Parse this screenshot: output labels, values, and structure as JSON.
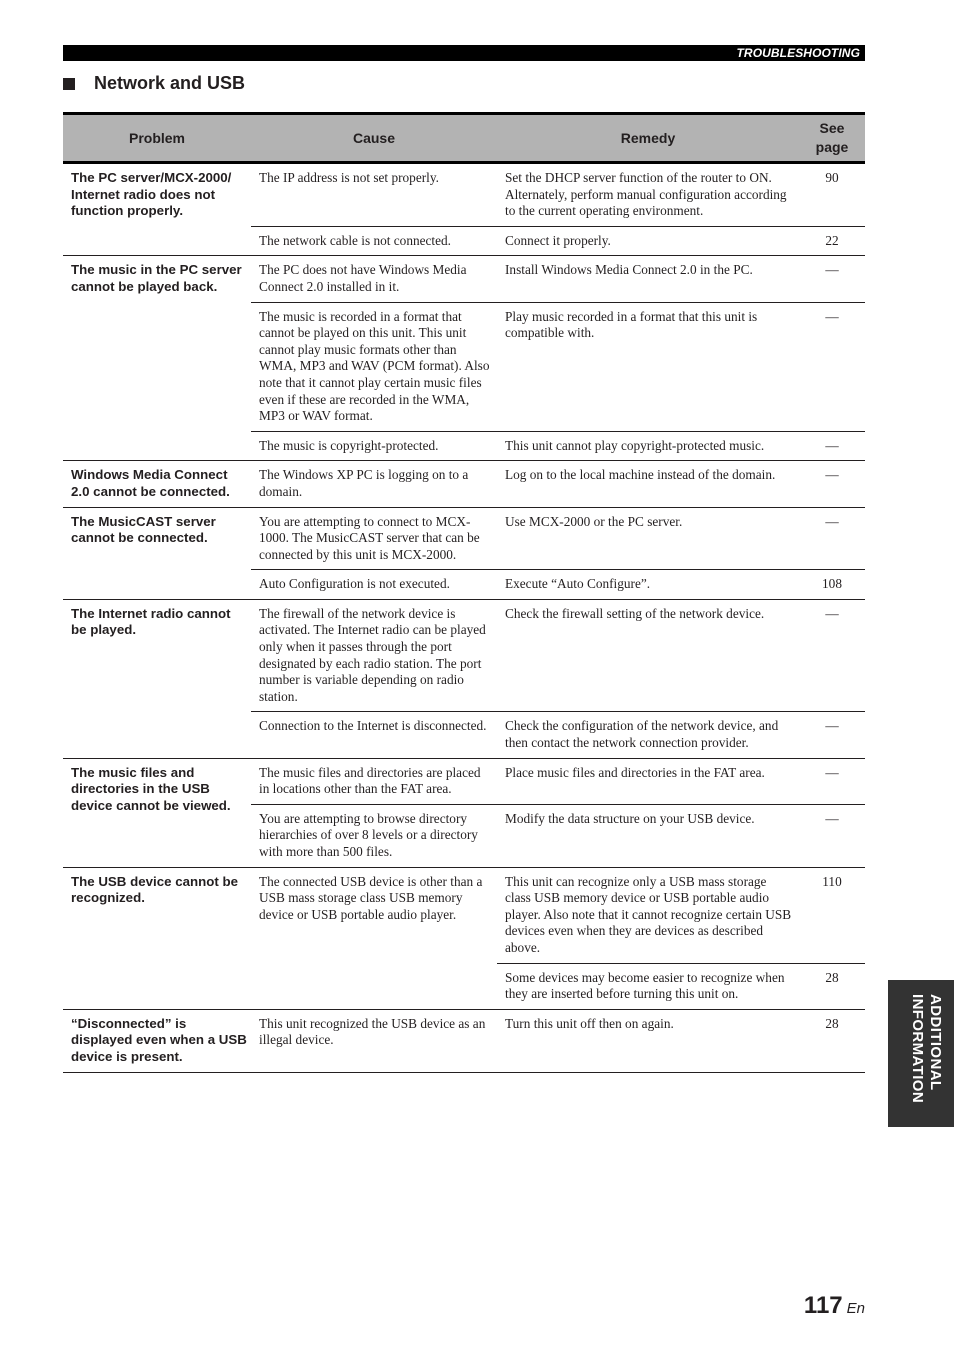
{
  "header": {
    "section_label": "TROUBLESHOOTING"
  },
  "section": {
    "title": "Network and USB"
  },
  "table": {
    "columns": [
      "Problem",
      "Cause",
      "Remedy",
      "See page"
    ],
    "columns_split": {
      "see": "See",
      "page": "page"
    },
    "groups": [
      {
        "problem": "The PC server/MCX-2000/ Internet radio does not function properly.",
        "rows": [
          {
            "cause": "The IP address is not set properly.",
            "remedy": "Set the DHCP server function of the router to ON. Alternately, perform manual configuration according to the current operating environment.",
            "page": "90"
          },
          {
            "cause": "The network cable is not connected.",
            "remedy": "Connect it properly.",
            "page": "22"
          }
        ]
      },
      {
        "problem": "The music in the PC server cannot be played back.",
        "rows": [
          {
            "cause": "The PC does not have Windows Media Connect 2.0 installed in it.",
            "remedy": "Install Windows Media Connect 2.0 in the PC.",
            "page": "—"
          },
          {
            "cause": "The music is recorded in a format that cannot be played on this unit. This unit cannot play music formats other than WMA, MP3 and WAV (PCM format). Also note that it cannot play certain music files even if these are recorded in the WMA, MP3 or WAV format.",
            "remedy": "Play music recorded in a format that this unit is compatible with.",
            "page": "—"
          },
          {
            "cause": "The music is copyright-protected.",
            "remedy": "This unit cannot play copyright-protected music.",
            "page": "—"
          }
        ]
      },
      {
        "problem": "Windows Media Connect 2.0 cannot be connected.",
        "rows": [
          {
            "cause": "The Windows XP PC is logging on to a domain.",
            "remedy": "Log on to the local machine instead of the domain.",
            "page": "—"
          }
        ]
      },
      {
        "problem": "The MusicCAST server cannot be connected.",
        "rows": [
          {
            "cause": "You are attempting to connect to MCX-1000. The MusicCAST server that can be connected by this unit is MCX-2000.",
            "remedy": "Use MCX-2000 or the PC server.",
            "page": "—"
          },
          {
            "cause": "Auto Configuration is not executed.",
            "remedy": "Execute “Auto Configure”.",
            "page": "108"
          }
        ]
      },
      {
        "problem": "The Internet radio cannot be played.",
        "rows": [
          {
            "cause": "The firewall of the network device is activated. The Internet radio can be played only when it passes through the port designated by each radio station. The port number is variable depending on radio station.",
            "remedy": "Check the firewall setting of the network device.",
            "page": "—"
          },
          {
            "cause": "Connection to the Internet is disconnected.",
            "remedy": "Check the configuration of the network device, and then contact the network connection provider.",
            "page": "—"
          }
        ]
      },
      {
        "problem": "The music files and directories in the USB device cannot be viewed.",
        "rows": [
          {
            "cause": "The music files and directories are placed in locations other than the FAT area.",
            "remedy": "Place music files and directories in the FAT area.",
            "page": "—"
          },
          {
            "cause": "You are attempting to browse directory hierarchies of over 8 levels or a directory with more than 500 files.",
            "remedy": "Modify the data structure on your USB device.",
            "page": "—"
          }
        ]
      },
      {
        "problem": "The USB device cannot be recognized.",
        "cause": "The connected USB device is other than a USB mass storage class USB memory device or USB portable audio player.",
        "rows": [
          {
            "remedy": "This unit can recognize only a USB mass storage class USB memory device or USB portable audio player. Also note that it cannot recognize certain USB devices even when they are devices as described above.",
            "page": "110"
          },
          {
            "remedy": "Some devices may become easier to recognize when they are inserted before turning this unit on.",
            "page": "28"
          }
        ]
      },
      {
        "problem": "“Disconnected” is displayed even when a USB device is present.",
        "rows": [
          {
            "cause": "This unit recognized the USB device as an illegal device.",
            "remedy": "Turn this unit off then on again.",
            "page": "28"
          }
        ]
      }
    ]
  },
  "side_tab": {
    "line1": "ADDITIONAL",
    "line2": "INFORMATION"
  },
  "footer": {
    "page_number": "117",
    "lang": "En"
  }
}
